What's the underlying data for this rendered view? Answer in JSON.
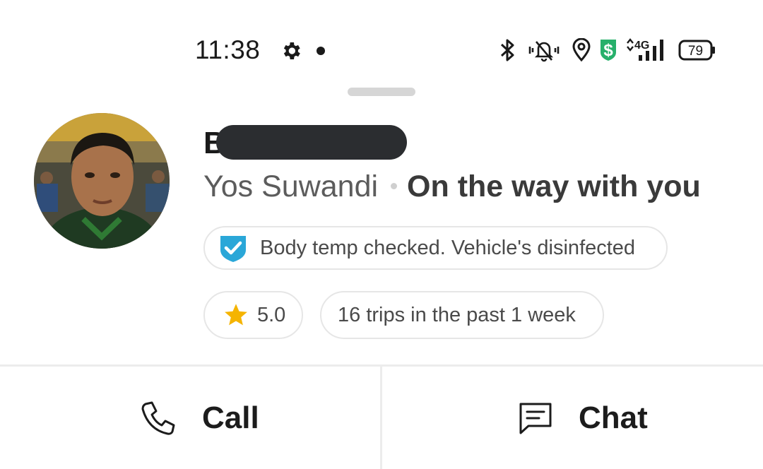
{
  "status_bar": {
    "time": "11:38",
    "network": "4G",
    "battery": "79",
    "icons": [
      "gear-icon",
      "notification-dot-icon",
      "bluetooth-icon",
      "silent-vibrate-icon",
      "location-icon",
      "dollar-shield-icon",
      "signal-icon",
      "battery-icon"
    ]
  },
  "driver": {
    "name_visible": "B",
    "name_redacted": true,
    "vehicle_plate": "Yos Suwandi",
    "status": "On the way with you",
    "safety_badge": "Body temp checked. Vehicle's disinfected",
    "rating": "5.0",
    "trips": "16 trips in the past 1 week"
  },
  "actions": {
    "call_label": "Call",
    "chat_label": "Chat"
  },
  "colors": {
    "shield": "#2aa7d8",
    "star": "#f5b400",
    "dollar_icon": "#27b06b"
  }
}
